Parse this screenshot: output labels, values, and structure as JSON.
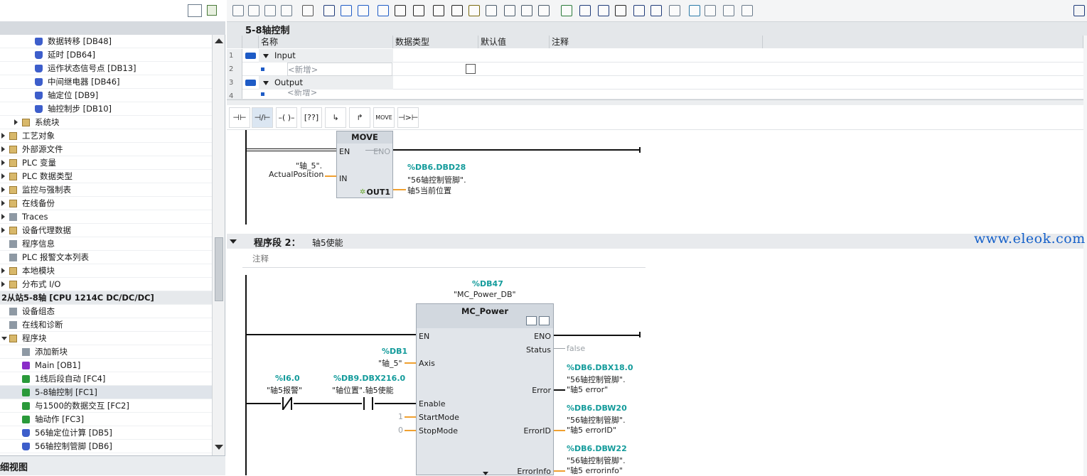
{
  "tree": {
    "items": [
      {
        "label": "数据转移 [DB48]",
        "icon": "db-icon",
        "indent": 2
      },
      {
        "label": "延时 [DB64]",
        "icon": "db-icon",
        "indent": 2
      },
      {
        "label": "运作状态信号点 [DB13]",
        "icon": "db-icon",
        "indent": 2
      },
      {
        "label": "中间继电器 [DB46]",
        "icon": "db-icon",
        "indent": 2
      },
      {
        "label": "轴定位 [DB9]",
        "icon": "db-icon",
        "indent": 2
      },
      {
        "label": "轴控制步 [DB10]",
        "icon": "db-icon",
        "indent": 2
      },
      {
        "label": "系统块",
        "icon": "folder-icon",
        "indent": 1,
        "arrow": "right"
      },
      {
        "label": "工艺对象",
        "icon": "folder-icon",
        "indent": 0,
        "arrow": "right"
      },
      {
        "label": "外部源文件",
        "icon": "folder-icon",
        "indent": 0,
        "arrow": "right"
      },
      {
        "label": "PLC 变量",
        "icon": "folder-icon",
        "indent": 0,
        "arrow": "right"
      },
      {
        "label": "PLC 数据类型",
        "icon": "folder-icon",
        "indent": 0,
        "arrow": "right"
      },
      {
        "label": "监控与强制表",
        "icon": "folder-icon",
        "indent": 0,
        "arrow": "right"
      },
      {
        "label": "在线备份",
        "icon": "folder-icon",
        "indent": 0,
        "arrow": "right"
      },
      {
        "label": "Traces",
        "icon": "trace-icon",
        "indent": 0,
        "arrow": "right"
      },
      {
        "label": "设备代理数据",
        "icon": "folder-icon",
        "indent": 0,
        "arrow": "right"
      },
      {
        "label": "程序信息",
        "icon": "info-icon",
        "indent": 0
      },
      {
        "label": "PLC 报警文本列表",
        "icon": "list-icon",
        "indent": 0
      },
      {
        "label": "本地模块",
        "icon": "folder-icon",
        "indent": 0,
        "arrow": "right"
      },
      {
        "label": "分布式 I/O",
        "icon": "folder-icon",
        "indent": 0,
        "arrow": "right"
      },
      {
        "label": "2从站5-8轴 [CPU 1214C DC/DC/DC]",
        "icon": "",
        "indent": -1,
        "bold": true
      },
      {
        "label": "设备组态",
        "icon": "device-icon",
        "indent": 0
      },
      {
        "label": "在线和诊断",
        "icon": "diag-icon",
        "indent": 0
      },
      {
        "label": "程序块",
        "icon": "folder-icon",
        "indent": 0,
        "arrow": "down"
      },
      {
        "label": "添加新块",
        "icon": "add-icon",
        "indent": 1
      },
      {
        "label": "Main [OB1]",
        "icon": "ob-icon",
        "indent": 1
      },
      {
        "label": "1线后段自动 [FC4]",
        "icon": "fc-icon",
        "indent": 1
      },
      {
        "label": "5-8轴控制 [FC1]",
        "icon": "fc-icon",
        "indent": 1,
        "selected": true
      },
      {
        "label": "与1500的数据交互 [FC2]",
        "icon": "fc-icon",
        "indent": 1
      },
      {
        "label": "轴动作 [FC3]",
        "icon": "fc-icon",
        "indent": 1
      },
      {
        "label": "56轴定位计算 [DB5]",
        "icon": "db-icon",
        "indent": 1
      },
      {
        "label": "56轴控制管脚 [DB6]",
        "icon": "db-icon",
        "indent": 1
      }
    ],
    "bottom_label": "细视图"
  },
  "editor": {
    "block_title": "5-8轴控制",
    "columns": [
      "名称",
      "数据类型",
      "默认值",
      "注释"
    ],
    "rows": [
      {
        "num": "1",
        "name": "Input",
        "type": "",
        "group": true
      },
      {
        "num": "2",
        "name": "<新增>",
        "type": "",
        "group": false
      },
      {
        "num": "3",
        "name": "Output",
        "type": "",
        "group": true
      },
      {
        "num": "4",
        "name": "<新增>",
        "type": "",
        "group": false
      }
    ]
  },
  "instr_toolbar": {
    "move_label": "MOVE"
  },
  "network1": {
    "box_title": "MOVE",
    "en": "EN",
    "eno": "ENO",
    "in": "IN",
    "out": "OUT1",
    "in_tag_line1": "\"轴_5\".",
    "in_tag_line2": "ActualPosition",
    "out_addr": "%DB6.DBD28",
    "out_tag_line1": "\"56轴控制管脚\".",
    "out_tag_line2": "轴5当前位置"
  },
  "network2": {
    "header": "程序段 2：",
    "title": "轴5使能",
    "comment": "注释",
    "instance_addr": "%DB47",
    "instance_name": "\"MC_Power_DB\"",
    "box_title": "MC_Power",
    "pins_left": [
      "EN",
      "Axis",
      "Enable",
      "StartMode",
      "StopMode"
    ],
    "pins_right": [
      "ENO",
      "Status",
      "Error",
      "ErrorID",
      "ErrorInfo"
    ],
    "axis_addr": "%DB1",
    "axis_tag": "\"轴_5\"",
    "contact1_addr": "%I6.0",
    "contact1_tag": "\"轴5报警\"",
    "contact2_addr": "%DB9.DBX216.0",
    "contact2_tag": "\"轴位置\".轴5使能",
    "startmode_val": "1",
    "stopmode_val": "0",
    "status_val": "false",
    "error_addr": "%DB6.DBX18.0",
    "error_tag1": "\"56轴控制管脚\".",
    "error_tag2": "\"轴5 error\"",
    "errorid_addr": "%DB6.DBW20",
    "errorid_tag1": "\"56轴控制管脚\".",
    "errorid_tag2": "\"轴5 errorID\"",
    "errorinfo_addr": "%DB6.DBW22",
    "errorinfo_tag1": "\"56轴控制管脚\".",
    "errorinfo_tag2": "\"轴5 errorinfo\""
  },
  "watermark": "www.eleok.com",
  "colors": {
    "teal": "#139b9b",
    "orange": "#f0a030",
    "selected_row": "#dfe4ea",
    "header_grey": "#e4e7ea"
  }
}
